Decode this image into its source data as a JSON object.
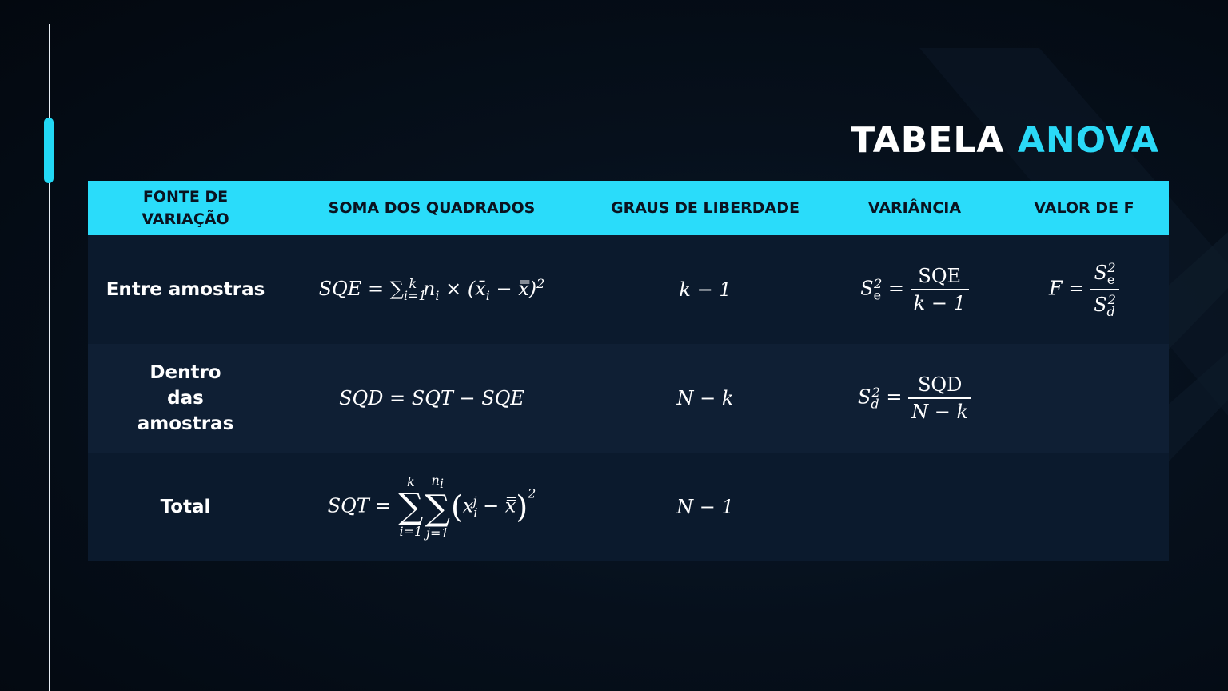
{
  "title": {
    "main": "TABELA",
    "accent": "ANOVA"
  },
  "colors": {
    "accent": "#2adcfa",
    "background": "#050c16",
    "row_dark": "#0b1a2d",
    "row_light": "#0f1f34"
  },
  "table": {
    "headers": [
      "FONTE DE VARIAÇÃO",
      "SOMA DOS QUADRADOS",
      "GRAUS DE LIBERDADE",
      "VARIÂNCIA",
      "VALOR DE F"
    ],
    "rows": [
      {
        "source": "Entre amostras",
        "sum_of_squares": "SQE = ∑_{i=1}^{k} n_i × (x̄_i − x̿)²",
        "degrees_of_freedom": "k − 1",
        "variance": "S²_e = SQE / (k − 1)",
        "f_value": "F = S²_e / S²_d"
      },
      {
        "source": "Dentro das amostras",
        "sum_of_squares": "SQD = SQT − SQE",
        "degrees_of_freedom": "N − k",
        "variance": "S²_d = SQD / (N − k)",
        "f_value": ""
      },
      {
        "source": "Total",
        "sum_of_squares": "SQT = ∑_{i=1}^{k} ∑_{j=1}^{n_i} (x_i^j − x̿)²",
        "degrees_of_freedom": "N − 1",
        "variance": "",
        "f_value": ""
      }
    ]
  }
}
